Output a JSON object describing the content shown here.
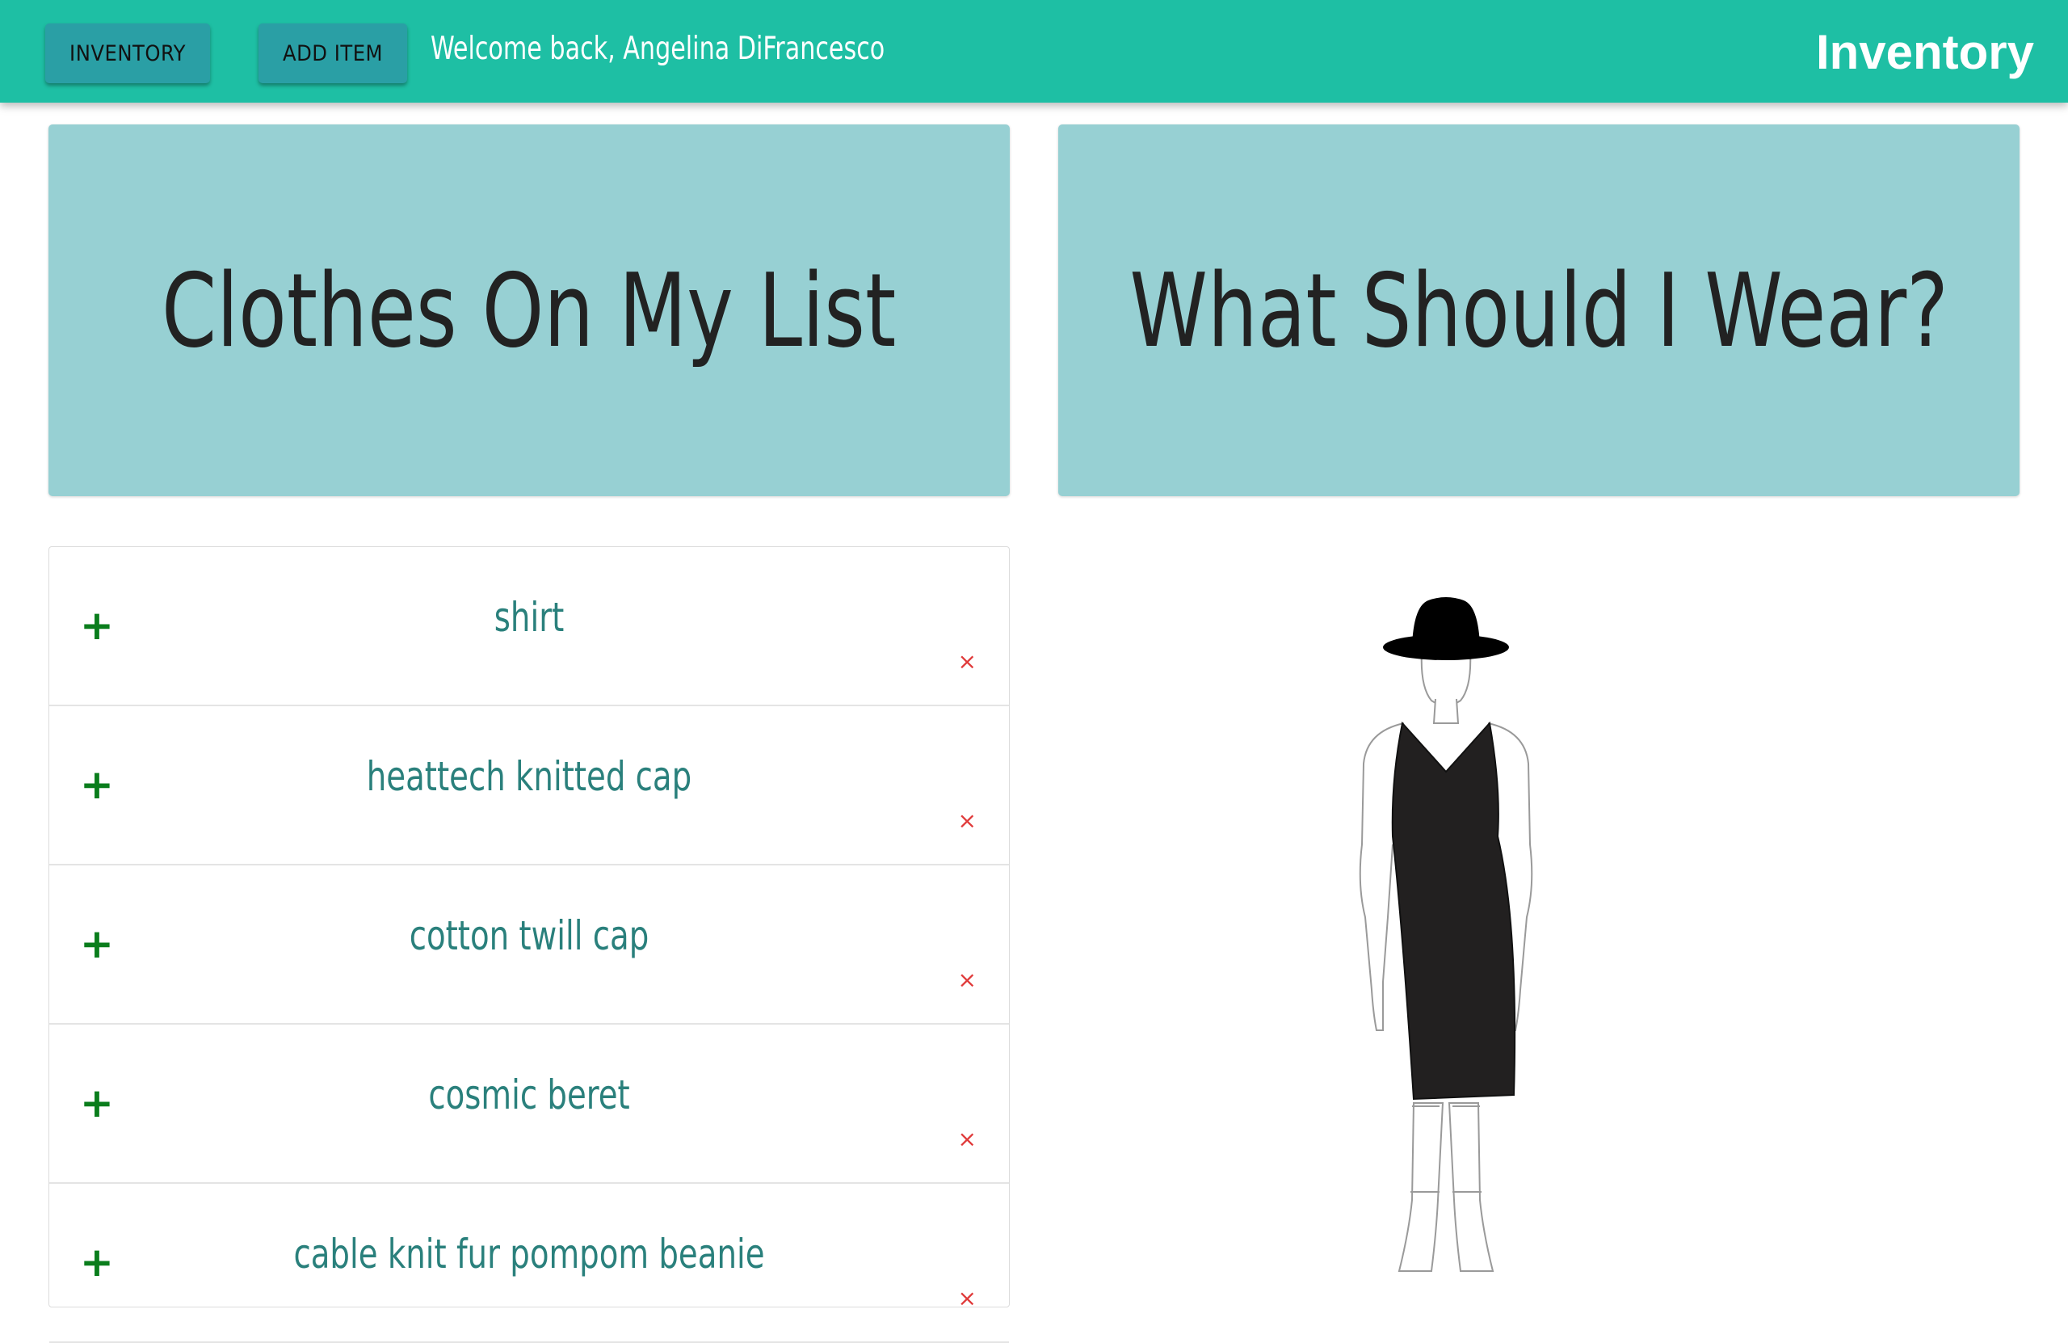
{
  "nav": {
    "inventory_label": "INVENTORY",
    "add_item_label": "ADD ITEM",
    "welcome_text": "Welcome back, Angelina DiFrancesco",
    "brand": "Inventory"
  },
  "panels": {
    "left_title": "Clothes On My List",
    "right_title": "What Should I Wear?"
  },
  "list": {
    "add_symbol": "+",
    "remove_symbol": "×",
    "items": [
      {
        "name": "shirt"
      },
      {
        "name": "heattech knitted cap"
      },
      {
        "name": "cotton twill cap"
      },
      {
        "name": "cosmic beret"
      },
      {
        "name": "cable knit fur pompom beanie"
      }
    ]
  },
  "colors": {
    "topbar": "#1ebfa4",
    "nav_button": "#2a9fa5",
    "hero_panel": "#97d0d3",
    "item_text": "#2a807c",
    "add_icon": "#0a7d1c",
    "remove_icon": "#e03a3a"
  }
}
